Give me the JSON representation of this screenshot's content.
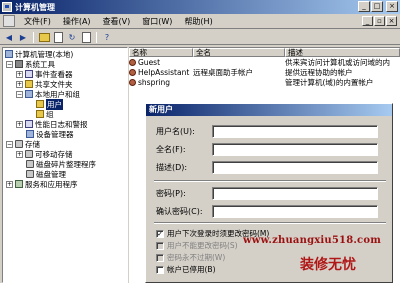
{
  "window": {
    "title": "计算机管理"
  },
  "menu": [
    "文件(F)",
    "操作(A)",
    "查看(V)",
    "窗口(W)",
    "帮助(H)"
  ],
  "tree": [
    {
      "label": "计算机管理(本地)",
      "icon": "computer-icon"
    },
    {
      "label": "系统工具",
      "icon": "tools-icon"
    },
    {
      "label": "事件查看器",
      "icon": "event-viewer-icon"
    },
    {
      "label": "共享文件夹",
      "icon": "shared-folder-icon"
    },
    {
      "label": "本地用户和组",
      "icon": "users-groups-icon"
    },
    {
      "label": "用户",
      "icon": "folder-icon"
    },
    {
      "label": "组",
      "icon": "folder-icon"
    },
    {
      "label": "性能日志和警报",
      "icon": "performance-log-icon"
    },
    {
      "label": "设备管理器",
      "icon": "device-manager-icon"
    },
    {
      "label": "存储",
      "icon": "storage-icon"
    },
    {
      "label": "可移动存储",
      "icon": "removable-storage-icon"
    },
    {
      "label": "磁盘碎片整理程序",
      "icon": "defrag-icon"
    },
    {
      "label": "磁盘管理",
      "icon": "disk-management-icon"
    },
    {
      "label": "服务和应用程序",
      "icon": "services-icon"
    }
  ],
  "list": {
    "headers": [
      "名称",
      "全名",
      "描述"
    ],
    "rows": [
      {
        "name": "Guest",
        "fullname": "",
        "desc": "供来宾访问计算机或访问域的内"
      },
      {
        "name": "HelpAssistant",
        "fullname": "远程桌面助手帐户",
        "desc": "提供远程协助的帐户"
      },
      {
        "name": "shspring",
        "fullname": "",
        "desc": "管理计算机(域)的内置帐户"
      }
    ]
  },
  "dialog": {
    "title": "新用户",
    "fields": [
      {
        "label": "用户名(U):",
        "value": ""
      },
      {
        "label": "全名(F):",
        "value": ""
      },
      {
        "label": "描述(D):",
        "value": ""
      }
    ],
    "password_label": "密码(P):",
    "password_value": "",
    "confirm_label": "确认密码(C):",
    "confirm_value": "",
    "checkboxes": [
      {
        "label": "用户下次登录时须更改密码(M)",
        "checked": true,
        "enabled": true
      },
      {
        "label": "用户不能更改密码(S)",
        "checked": false,
        "enabled": false
      },
      {
        "label": "密码永不过期(W)",
        "checked": false,
        "enabled": false
      },
      {
        "label": "帐户已停用(B)",
        "checked": false,
        "enabled": true
      }
    ]
  },
  "watermark": {
    "url": "www.zhuangxiu518.com",
    "brand": "装修无忧"
  }
}
